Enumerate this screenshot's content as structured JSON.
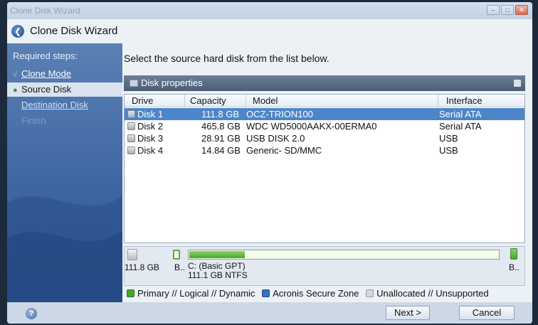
{
  "window": {
    "title": "Clone Disk Wizard",
    "controls": [
      "minimize",
      "restore",
      "close"
    ]
  },
  "header": {
    "title": "Clone Disk Wizard",
    "back_icon": "back-arrow-icon"
  },
  "sidebar": {
    "heading": "Required steps:",
    "steps": [
      {
        "label": "Clone Mode",
        "state": "done",
        "mark": "√"
      },
      {
        "label": "Source Disk",
        "state": "active",
        "mark": "●"
      },
      {
        "label": "Destination Disk",
        "state": "pending",
        "mark": ""
      },
      {
        "label": "Finish",
        "state": "disabled",
        "mark": ""
      }
    ]
  },
  "main": {
    "instruction": "Select the source hard disk from the list below.",
    "properties_bar": "Disk properties",
    "columns": [
      "Drive",
      "Capacity",
      "Model",
      "Interface"
    ],
    "disks": [
      {
        "drive": "Disk 1",
        "capacity": "111.8 GB",
        "model": "OCZ-TRION100",
        "interface": "Serial ATA",
        "selected": true
      },
      {
        "drive": "Disk 2",
        "capacity": "465.8 GB",
        "model": "WDC WD5000AAKX-00ERMA0",
        "interface": "Serial ATA",
        "selected": false
      },
      {
        "drive": "Disk 3",
        "capacity": "28.91 GB",
        "model": "USB DISK 2.0",
        "interface": "USB",
        "selected": false
      },
      {
        "drive": "Disk 4",
        "capacity": "14.84 GB",
        "model": "Generic- SD/MMC",
        "interface": "USB",
        "selected": false
      }
    ]
  },
  "partition": {
    "disk_size": "111.8 GB",
    "left_label": "B..",
    "right_label": "B..",
    "name": "C: (Basic GPT)",
    "details": "111.1 GB  NTFS",
    "used_fraction": 0.18
  },
  "legend": {
    "primary": "Primary // Logical // Dynamic",
    "secure_zone": "Acronis Secure Zone",
    "unallocated": "Unallocated // Unsupported"
  },
  "footer": {
    "next": "Next >",
    "cancel": "Cancel",
    "help_icon": "help-icon"
  },
  "colors": {
    "sidebar_top": "#5a80b4",
    "sidebar_bottom": "#2d5592",
    "selection": "#4d86c8",
    "primary_green": "#4aa52c",
    "secure_blue": "#3a6fc1"
  }
}
